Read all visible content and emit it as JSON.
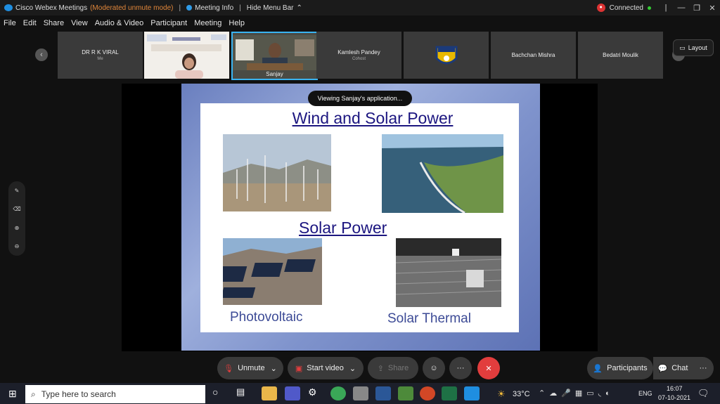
{
  "titlebar": {
    "app_name": "Cisco Webex Meetings",
    "mode": "(Moderated unmute mode)",
    "meeting_info": "Meeting Info",
    "hide_menu": "Hide Menu Bar",
    "status": "Connected",
    "minimize": "—",
    "restore": "❐",
    "close": "✕"
  },
  "menu": [
    "File",
    "Edit",
    "Share",
    "View",
    "Audio & Video",
    "Participant",
    "Meeting",
    "Help"
  ],
  "participants": [
    {
      "name": "DR R K VIRAL",
      "sub": "Me"
    },
    {
      "name": "Sanjay"
    },
    {
      "name": "Kamlesh Pandey",
      "sub": "Cohost"
    },
    {
      "name": "Bachchan Mishra"
    },
    {
      "name": "Bedatri Moulik"
    }
  ],
  "layout_label": "Layout",
  "viewing_label": "Viewing Sanjay's application...",
  "slide": {
    "title": "Wind and Solar Power",
    "subtitle": "Solar Power",
    "caption_left": "Photovoltaic",
    "caption_right": "Solar Thermal"
  },
  "controls": {
    "unmute": "Unmute",
    "start_video": "Start video",
    "share": "Share",
    "more": "···",
    "end": "✕",
    "participants": "Participants",
    "chat": "Chat"
  },
  "taskbar": {
    "search_placeholder": "Type here to search",
    "temperature": "33°C",
    "lang": "ENG",
    "time": "16:07",
    "date": "07-10-2021"
  },
  "colors": {
    "accent": "#1f8ee0",
    "end_call": "#e23d3d",
    "slide_title": "#1c1680"
  }
}
